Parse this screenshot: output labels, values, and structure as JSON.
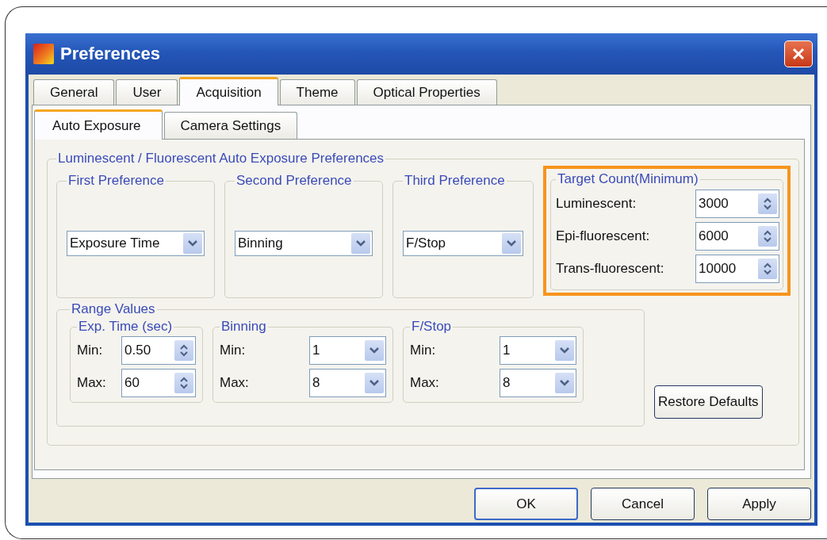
{
  "window": {
    "title": "Preferences"
  },
  "tabs": [
    {
      "label": "General",
      "selected": false
    },
    {
      "label": "User",
      "selected": false
    },
    {
      "label": "Acquisition",
      "selected": true
    },
    {
      "label": "Theme",
      "selected": false
    },
    {
      "label": "Optical Properties",
      "selected": false
    }
  ],
  "subtabs": [
    {
      "label": "Auto Exposure",
      "selected": true
    },
    {
      "label": "Camera Settings",
      "selected": false
    }
  ],
  "group_title": "Luminescent / Fluorescent Auto Exposure Preferences",
  "preferences": [
    {
      "title": "First Preference",
      "value": "Exposure Time"
    },
    {
      "title": "Second Preference",
      "value": "Binning"
    },
    {
      "title": "Third Preference",
      "value": "F/Stop"
    }
  ],
  "target_count": {
    "title": "Target Count(Minimum)",
    "highlighted": true,
    "fields": [
      {
        "label": "Luminescent:",
        "value": "3000"
      },
      {
        "label": "Epi-fluorescent:",
        "value": "6000"
      },
      {
        "label": "Trans-fluorescent:",
        "value": "10000"
      }
    ]
  },
  "range_values": {
    "title": "Range Values",
    "groups": [
      {
        "title": "Exp. Time (sec)",
        "kind": "spinner",
        "rows": [
          {
            "label": "Min:",
            "value": "0.50"
          },
          {
            "label": "Max:",
            "value": "60"
          }
        ]
      },
      {
        "title": "Binning",
        "kind": "dropdown",
        "rows": [
          {
            "label": "Min:",
            "value": "1"
          },
          {
            "label": "Max:",
            "value": "8"
          }
        ]
      },
      {
        "title": "F/Stop",
        "kind": "dropdown",
        "rows": [
          {
            "label": "Min:",
            "value": "1"
          },
          {
            "label": "Max:",
            "value": "8"
          }
        ]
      }
    ]
  },
  "restore_button": "Restore Defaults",
  "buttons": [
    {
      "label": "OK",
      "default": true
    },
    {
      "label": "Cancel",
      "default": false
    },
    {
      "label": "Apply",
      "default": false
    }
  ]
}
